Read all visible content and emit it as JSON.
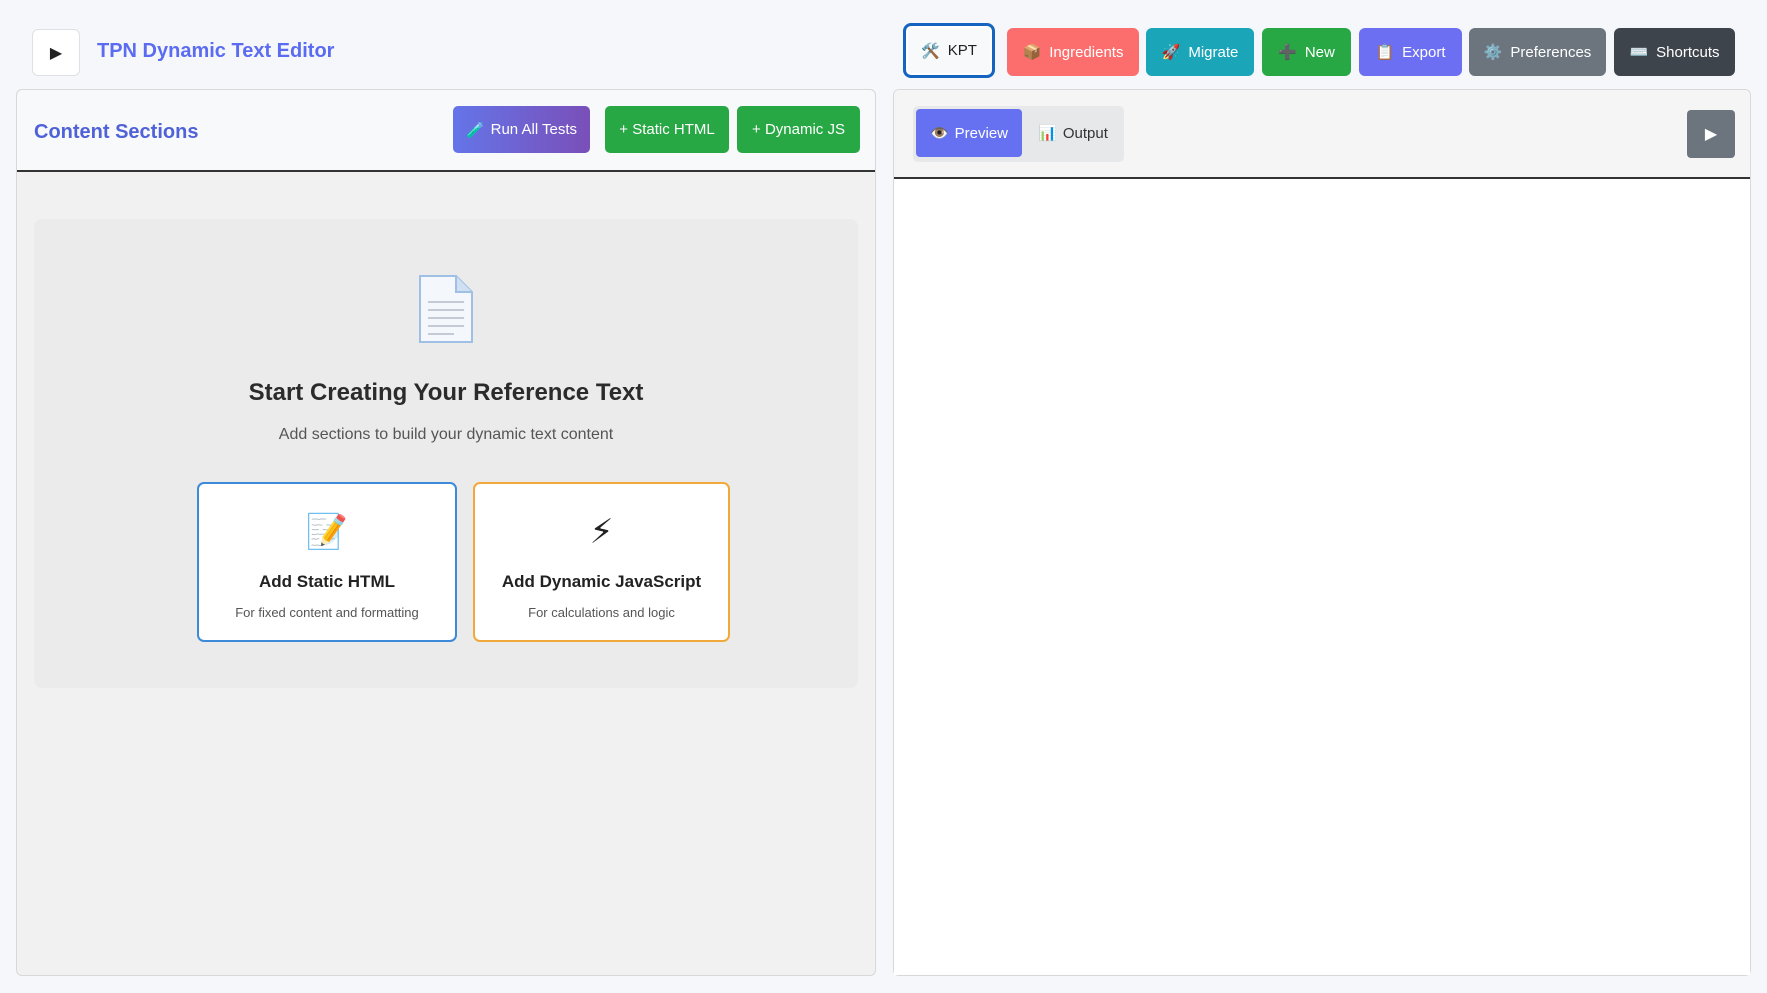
{
  "header": {
    "toggle_icon": "play-triangle",
    "toggle_glyph": "▶",
    "title": "TPN Dynamic Text Editor",
    "buttons": [
      {
        "icon": "🛠️",
        "label": "KPT"
      },
      {
        "icon": "📦",
        "label": "Ingredients"
      },
      {
        "icon": "🚀",
        "label": "Migrate"
      },
      {
        "icon": "➕",
        "label": "New"
      },
      {
        "icon": "📋",
        "label": "Export"
      },
      {
        "icon": "⚙️",
        "label": "Preferences"
      },
      {
        "icon": "⌨️",
        "label": "Shortcuts"
      }
    ]
  },
  "left_panel": {
    "title": "Content Sections",
    "run_tests": {
      "icon": "🧪",
      "label": "Run All Tests"
    },
    "add_static": "+ Static HTML",
    "add_dynamic": "+ Dynamic JS",
    "empty_state": {
      "icon": "document-icon",
      "title": "Start Creating Your Reference Text",
      "subtitle": "Add sections to build your dynamic text content",
      "cards": [
        {
          "icon": "📝",
          "title": "Add Static HTML",
          "subtitle": "For fixed content and formatting",
          "border_color": "#3d8ad8"
        },
        {
          "icon": "⚡",
          "title": "Add Dynamic JavaScript",
          "subtitle": "For calculations and logic",
          "border_color": "#f0a93a"
        }
      ]
    }
  },
  "right_panel": {
    "tabs": [
      {
        "icon": "👁️",
        "label": "Preview",
        "active": true
      },
      {
        "icon": "📊",
        "label": "Output",
        "active": false
      }
    ],
    "toggle_glyph": "▶"
  },
  "colors": {
    "accent": "#5b6cf0",
    "ingredients": "#fc6e6e",
    "migrate": "#1ba5b8",
    "new": "#28a745",
    "export": "#6c6ff2",
    "preferences": "#6c757d",
    "shortcuts": "#3e444b"
  }
}
